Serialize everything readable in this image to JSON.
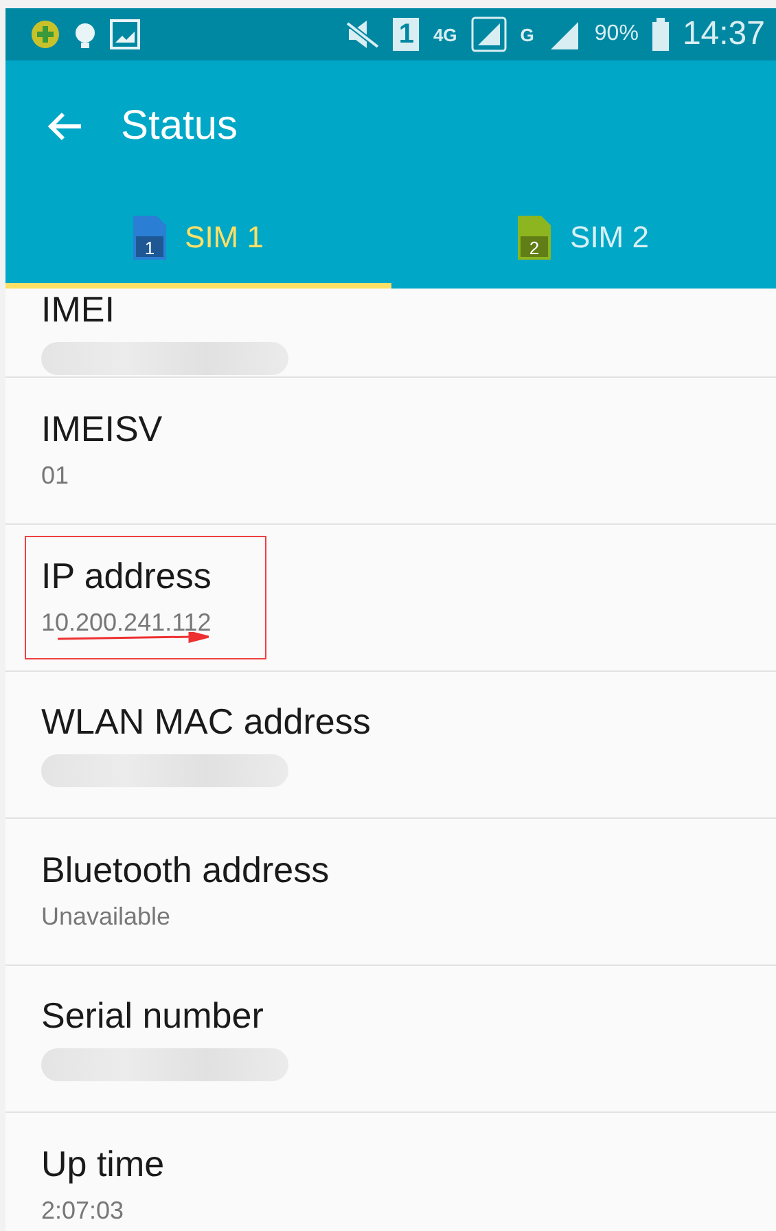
{
  "status_bar": {
    "sim_number": "1",
    "network_type": "4G",
    "second_network_type": "G",
    "battery": "90%",
    "time": "14:37"
  },
  "app_bar": {
    "title": "Status"
  },
  "tabs": [
    {
      "label": "SIM 1",
      "sim_number": "1",
      "color": "#2a7fd4",
      "selected": true
    },
    {
      "label": "SIM 2",
      "sim_number": "2",
      "color": "#8cb520",
      "selected": false
    }
  ],
  "items": [
    {
      "title": "IMEI",
      "redacted": true,
      "highlighted": false
    },
    {
      "title": "IMEISV",
      "value": "01",
      "redacted": false,
      "highlighted": false
    },
    {
      "title": "IP address",
      "value": "10.200.241.112",
      "redacted": false,
      "highlighted": true
    },
    {
      "title": "WLAN MAC address",
      "redacted": true,
      "highlighted": false
    },
    {
      "title": "Bluetooth address",
      "value": "Unavailable",
      "redacted": false,
      "highlighted": false
    },
    {
      "title": "Serial number",
      "redacted": true,
      "highlighted": false
    },
    {
      "title": "Up time",
      "value": "2:07:03",
      "redacted": false,
      "highlighted": false
    }
  ]
}
